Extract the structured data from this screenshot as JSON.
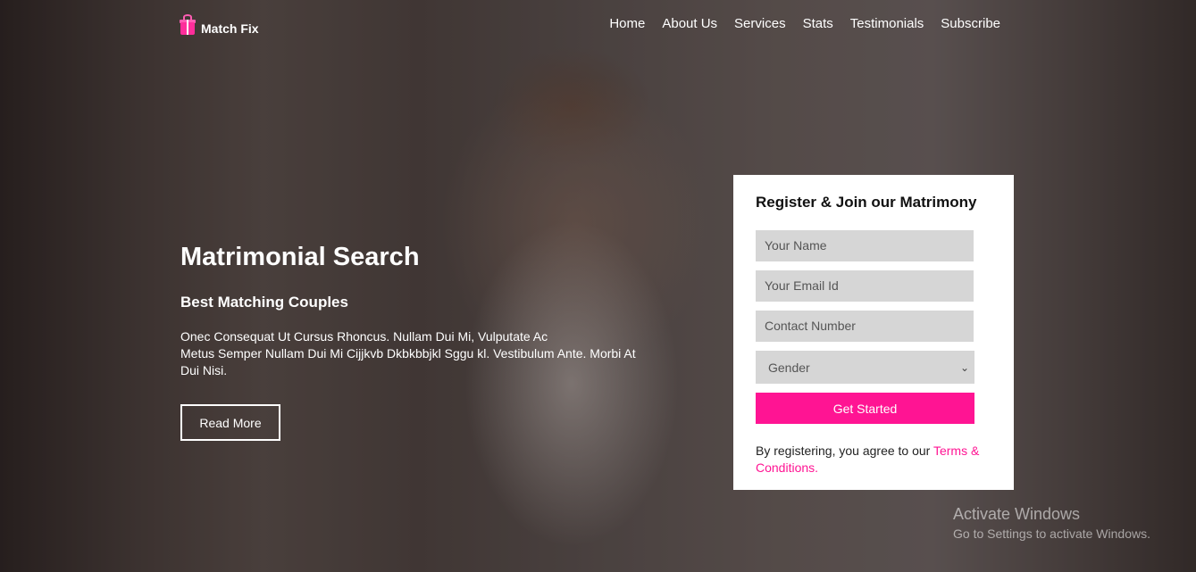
{
  "brand": {
    "name": "Match Fix",
    "icon": "gift-icon"
  },
  "nav": {
    "items": [
      "Home",
      "About Us",
      "Services",
      "Stats",
      "Testimonials",
      "Subscribe"
    ]
  },
  "hero": {
    "title": "Matrimonial Search",
    "subtitle": "Best Matching Couples",
    "paragraph_lines": [
      "Onec Consequat Ut Cursus Rhoncus. Nullam Dui Mi, Vulputate Ac",
      "Metus Semper Nullam Dui Mi Cijjkvb Dkbkbbjkl Sggu kl. Vestibulum Ante. Morbi At",
      "Dui Nisi."
    ],
    "cta": "Read More"
  },
  "register": {
    "title": "Register & Join our Matrimony",
    "name_placeholder": "Your Name",
    "email_placeholder": "Your Email Id",
    "phone_placeholder": "Contact Number",
    "gender_selected": "Gender",
    "submit": "Get Started",
    "terms_prefix": "By registering, you agree to our",
    "terms_link": "Terms & Conditions."
  },
  "watermark": {
    "line1": "Activate Windows",
    "line2": "Go to Settings to activate Windows."
  },
  "colors": {
    "accent": "#ff1493",
    "field_bg": "#d6d6d6"
  }
}
